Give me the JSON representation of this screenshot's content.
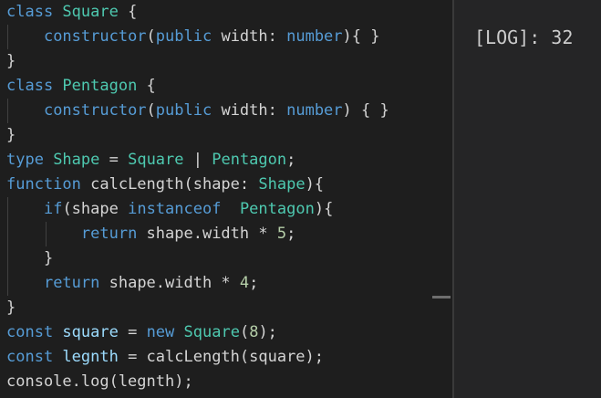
{
  "editor": {
    "lines": [
      [
        {
          "t": "class ",
          "c": "kw"
        },
        {
          "t": "Square",
          "c": "cls"
        },
        {
          "t": " {",
          "c": "plain"
        }
      ],
      [
        {
          "t": "    ",
          "c": "plain"
        },
        {
          "t": "constructor",
          "c": "kw"
        },
        {
          "t": "(",
          "c": "plain"
        },
        {
          "t": "public",
          "c": "kw"
        },
        {
          "t": " width: ",
          "c": "plain"
        },
        {
          "t": "number",
          "c": "kw"
        },
        {
          "t": "){ }",
          "c": "plain"
        }
      ],
      [
        {
          "t": "}",
          "c": "plain"
        }
      ],
      [
        {
          "t": "class ",
          "c": "kw"
        },
        {
          "t": "Pentagon",
          "c": "cls"
        },
        {
          "t": " {",
          "c": "plain"
        }
      ],
      [
        {
          "t": "    ",
          "c": "plain"
        },
        {
          "t": "constructor",
          "c": "kw"
        },
        {
          "t": "(",
          "c": "plain"
        },
        {
          "t": "public",
          "c": "kw"
        },
        {
          "t": " width: ",
          "c": "plain"
        },
        {
          "t": "number",
          "c": "kw"
        },
        {
          "t": ") { }",
          "c": "plain"
        }
      ],
      [
        {
          "t": "}",
          "c": "plain"
        }
      ],
      [
        {
          "t": "type ",
          "c": "kw"
        },
        {
          "t": "Shape",
          "c": "cls"
        },
        {
          "t": " = ",
          "c": "plain"
        },
        {
          "t": "Square",
          "c": "cls"
        },
        {
          "t": " | ",
          "c": "plain"
        },
        {
          "t": "Pentagon",
          "c": "cls"
        },
        {
          "t": ";",
          "c": "plain"
        }
      ],
      [
        {
          "t": "function ",
          "c": "kw"
        },
        {
          "t": "calcLength",
          "c": "plain"
        },
        {
          "t": "(shape: ",
          "c": "plain"
        },
        {
          "t": "Shape",
          "c": "cls"
        },
        {
          "t": "){",
          "c": "plain"
        }
      ],
      [
        {
          "t": "    ",
          "c": "plain"
        },
        {
          "t": "if",
          "c": "kw"
        },
        {
          "t": "(shape ",
          "c": "plain"
        },
        {
          "t": "instanceof",
          "c": "kw"
        },
        {
          "t": "  ",
          "c": "plain"
        },
        {
          "t": "Pentagon",
          "c": "cls"
        },
        {
          "t": "){",
          "c": "plain"
        }
      ],
      [
        {
          "t": "        ",
          "c": "plain"
        },
        {
          "t": "return",
          "c": "kw"
        },
        {
          "t": " shape.width * ",
          "c": "plain"
        },
        {
          "t": "5",
          "c": "num"
        },
        {
          "t": ";",
          "c": "plain"
        }
      ],
      [
        {
          "t": "    }",
          "c": "plain"
        }
      ],
      [
        {
          "t": "    ",
          "c": "plain"
        },
        {
          "t": "return",
          "c": "kw"
        },
        {
          "t": " shape.width * ",
          "c": "plain"
        },
        {
          "t": "4",
          "c": "num"
        },
        {
          "t": ";",
          "c": "plain"
        }
      ],
      [
        {
          "t": "}",
          "c": "plain"
        }
      ],
      [
        {
          "t": "const ",
          "c": "kw"
        },
        {
          "t": "square",
          "c": "var"
        },
        {
          "t": " = ",
          "c": "plain"
        },
        {
          "t": "new ",
          "c": "kw"
        },
        {
          "t": "Square",
          "c": "cls"
        },
        {
          "t": "(",
          "c": "plain"
        },
        {
          "t": "8",
          "c": "num"
        },
        {
          "t": ");",
          "c": "plain"
        }
      ],
      [
        {
          "t": "const ",
          "c": "kw"
        },
        {
          "t": "legnth",
          "c": "var"
        },
        {
          "t": " = calcLength(square);",
          "c": "plain"
        }
      ],
      [
        {
          "t": "console.log(legnth);",
          "c": "plain"
        }
      ]
    ]
  },
  "output": {
    "log_text": "[LOG]: 32"
  }
}
